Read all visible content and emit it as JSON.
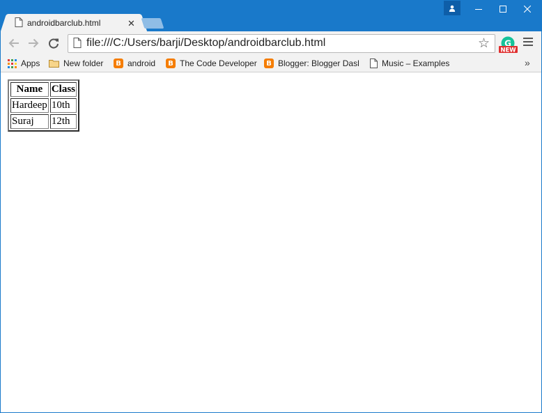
{
  "browser": {
    "tab": {
      "title": "androidbarclub.html",
      "close_glyph": "✕"
    },
    "address_bar": {
      "url": "file:///C:/Users/barji/Desktop/androidbarclub.html"
    },
    "extension_badge": "NEW",
    "bookmarks": [
      {
        "label": "Apps",
        "icon": "apps-grid-icon"
      },
      {
        "label": "New folder",
        "icon": "folder-icon"
      },
      {
        "label": "android",
        "icon": "blogger-icon"
      },
      {
        "label": "The Code Developer",
        "icon": "blogger-icon"
      },
      {
        "label": "Blogger: Blogger Dash",
        "icon": "blogger-icon"
      },
      {
        "label": "Music – Examples",
        "icon": "page-icon"
      }
    ],
    "overflow_glyph": "»",
    "colors": {
      "titlebar": "#1979ca",
      "toolbar": "#f2f2f2",
      "blogger": "#f57d00"
    }
  },
  "page": {
    "table": {
      "headers": [
        "Name",
        "Class"
      ],
      "rows": [
        [
          "Hardeep",
          "10th"
        ],
        [
          "Suraj",
          "12th"
        ]
      ]
    }
  }
}
